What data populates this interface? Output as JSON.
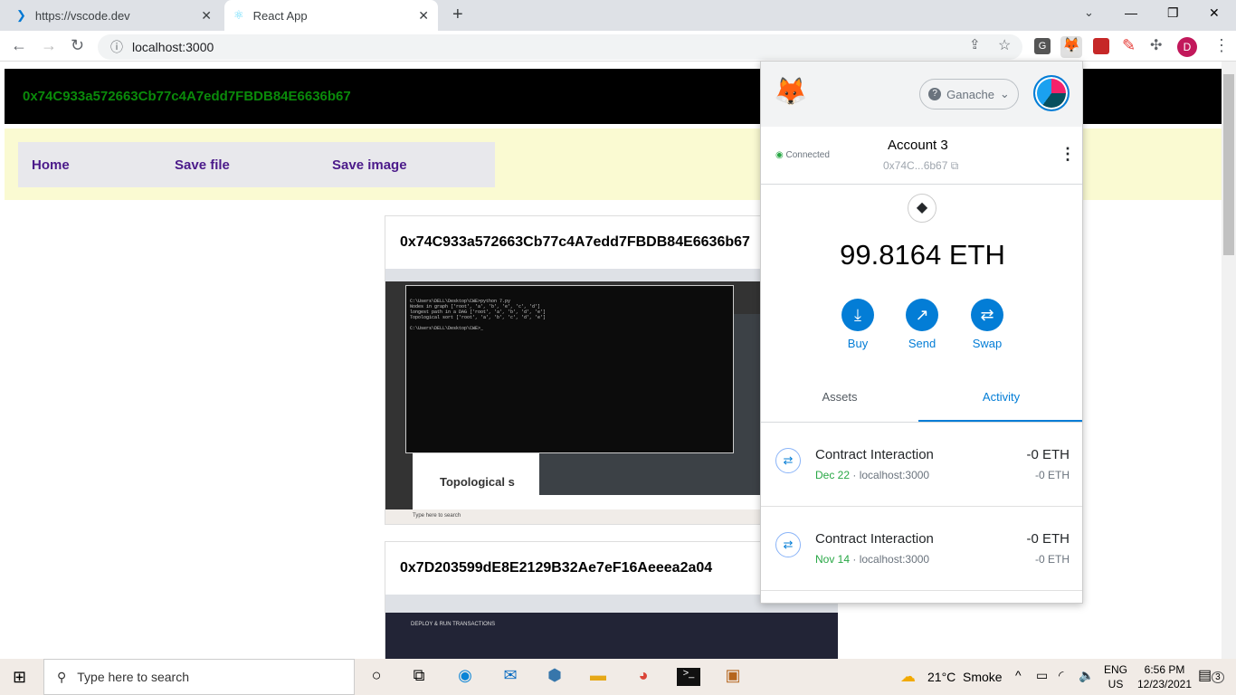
{
  "browser": {
    "tabs": [
      {
        "title": "https://vscode.dev"
      },
      {
        "title": "React App"
      }
    ],
    "url": "localhost:3000",
    "profile_initial": "D"
  },
  "app": {
    "header_address": "0x74C933a572663Cb77c4A7edd7FBDB84E6636b67",
    "nav": [
      "Home",
      "Save file",
      "Save image"
    ],
    "cards": [
      {
        "title": "0x74C933a572663Cb77c4A7edd7FBDB84E6636b67",
        "shot_text": [
          "C:\\Users\\DELL\\Desktop\\CWE>python 7.py",
          "Nodes in graph  ['root', 'a', 'b', 'e', 'c', 'd']",
          "longest path in a DAG  ['root', 'a', 'b', 'd', 'e']",
          "Topological sort  ['root', 'a', 'b', 'c', 'd', 'e']",
          "C:\\Users\\DELL\\Desktop\\CWE>_"
        ],
        "shot_heading": "Topological s",
        "shot_search": "Type here to search"
      },
      {
        "title": "0x7D203599dE8E2129B32Ae7eF16Aeeea2a04",
        "shot_heading": "DEPLOY & RUN TRANSACTIONS"
      }
    ]
  },
  "metamask": {
    "network": "Ganache",
    "status": "Connected",
    "account_name": "Account 3",
    "account_short": "0x74C...6b67",
    "balance": "99.8164 ETH",
    "actions": [
      "Buy",
      "Send",
      "Swap"
    ],
    "tabs": [
      "Assets",
      "Activity"
    ],
    "active_tab": "Activity",
    "transactions": [
      {
        "title": "Contract Interaction",
        "date": "Dec 22",
        "origin": "· localhost:3000",
        "amount": "-0 ETH",
        "sub_amount": "-0 ETH"
      },
      {
        "title": "Contract Interaction",
        "date": "Nov 14",
        "origin": "· localhost:3000",
        "amount": "-0 ETH",
        "sub_amount": "-0 ETH"
      }
    ]
  },
  "taskbar": {
    "search_placeholder": "Type here to search",
    "weather": "21°C",
    "weather_text": "Smoke",
    "lang": "ENG",
    "region": "US",
    "time": "6:56 PM",
    "date": "12/23/2021",
    "notifications": "3"
  }
}
